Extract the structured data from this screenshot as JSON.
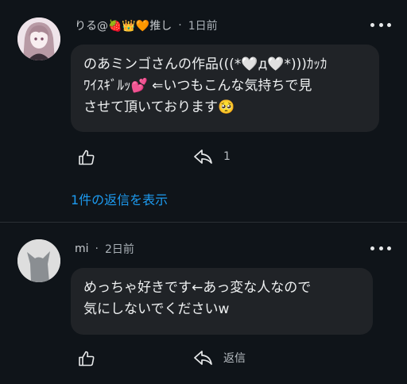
{
  "comments": [
    {
      "author": "りる@🍓👑🧡推し",
      "time": "1日前",
      "text": "のあミンゴさんの作品(((*🤍д🤍*)))ｶｯｶ\nﾜｲｽｷﾞﾙｯ💕 ⇐いつもこんな気持ちで見\nさせて頂いております🥺",
      "reply_label": "1",
      "show_replies": "1件の返信を表示"
    },
    {
      "author": "mi",
      "time": "2日前",
      "text": "めっちゃ好きです←あっ変な人なので\n気にしないでくださいw",
      "reply_label": "返信"
    }
  ],
  "meta_separator": "·",
  "colors": {
    "background": "#0f1419",
    "bubble": "#202327",
    "link": "#1d9bf0"
  },
  "icons": [
    "more-icon",
    "thumbs-up-icon",
    "reply-icon",
    "avatar-image",
    "default-avatar-icon"
  ]
}
